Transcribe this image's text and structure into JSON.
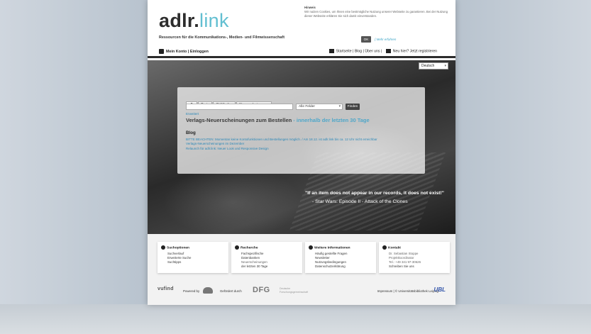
{
  "header": {
    "logo_part1": "adlr.",
    "logo_part2": "link",
    "tagline": "Ressourcen für die Kommunikations-, Medien- und Filmwissenschaft"
  },
  "cookie": {
    "title": "Hinweis",
    "text": "Wir nutzen Cookies, um Ihnen eine bestmögliche Nutzung unserer Webseite zu garantieren. Bei der Nutzung dieser Webseite erklären Sie sich damit einverstanden.",
    "ok_label": "OK",
    "more_label": "( Mehr erfahren"
  },
  "nav": {
    "account": "Mein Konto | Einloggen",
    "right": "Startseite | Blog | Über uns |",
    "register": "Neu hier? Jetzt registrieren"
  },
  "language": "Deutsch",
  "search": {
    "tabs": [
      "alle",
      "Texte",
      "AV-Medien",
      "Neuerscheinungen"
    ],
    "input_value": "",
    "field_select": "Alle Felder",
    "find_label": "Finden",
    "advanced": "Erweitert"
  },
  "new_heading": {
    "main": "Verlags-Neuerscheinungen zum Bestellen",
    "highlight": " - innerhalb der letzten 30 Tage"
  },
  "blog": {
    "title": "Blog",
    "items": [
      "BITTE BEACHTEN: Momentan keine Kontofunktionen und Bestellungen möglich. / Am 18.12. ist adlr.link bis ca. 12 Uhr nicht erreichbar",
      "Verlags-Neuerscheinungen im Dezember",
      "Relaunch für adlr.link: Neuer Look und Responsive Design"
    ]
  },
  "quote": {
    "text": "\"If an item does not appear in our records, it does not exist!\"",
    "source": "- Star Wars: Episode II - Attack of the Clones"
  },
  "footer": {
    "cards": [
      {
        "title": "Suchoptionen",
        "items": [
          "Suchverlauf",
          "Erweiterte Suche",
          "Suchtipps"
        ]
      },
      {
        "title": "Recherche",
        "items": [
          "Fachspezifische",
          "Datenbanken",
          "Neuerscheinungen",
          "der letzten 30 Tage"
        ]
      },
      {
        "title": "Weitere Informationen",
        "items": [
          "Häufig gestellte Fragen",
          "Newsletter",
          "Nutzungsbedingungen",
          "Datenschutzerklärung"
        ]
      },
      {
        "title": "Kontakt",
        "items": [
          "Dr. Sebastian Stoppe",
          "Projektkoordinator",
          "Tel.: +49 341 97-30626",
          "Schreiben Sie uns"
        ]
      }
    ],
    "vufind": "vufind",
    "powered_by": "Powered by",
    "funded_by": "Gefördert durch",
    "dfg": "DFG",
    "dfg_sub": "Deutsche Forschungsgemeinschaft",
    "imprint": "Impressum | © Universitätsbibliothek Leipzig",
    "ubl": "UBL"
  }
}
